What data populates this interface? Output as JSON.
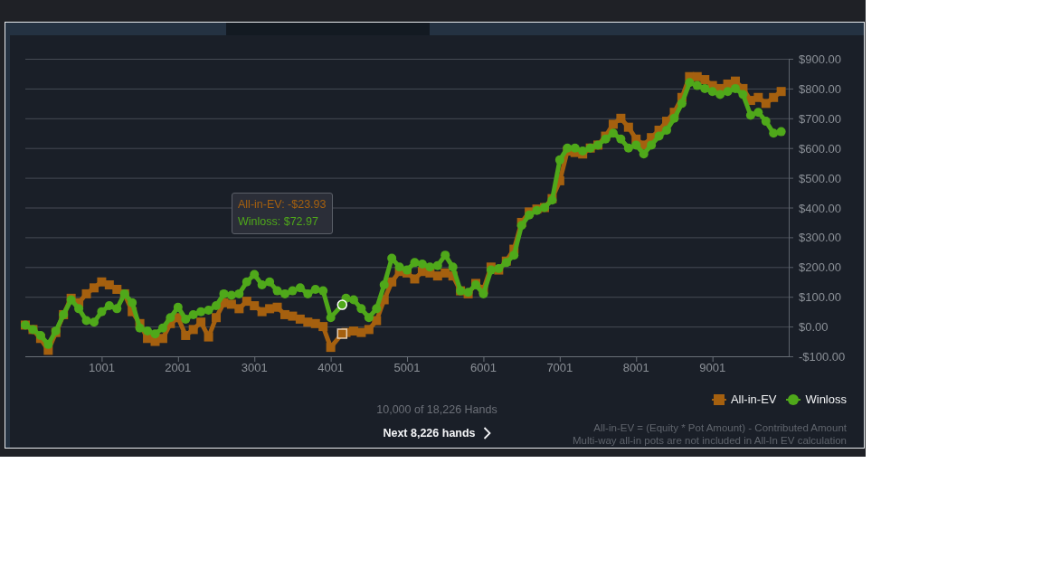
{
  "tabs": [
    {
      "selected": false
    },
    {
      "selected": true
    },
    {
      "selected": false
    }
  ],
  "chart": {
    "chart_data": {
      "type": "line",
      "grid": true,
      "x": [
        1,
        101,
        201,
        301,
        401,
        501,
        601,
        701,
        801,
        901,
        1001,
        1101,
        1201,
        1301,
        1401,
        1501,
        1601,
        1701,
        1801,
        1901,
        2001,
        2101,
        2201,
        2301,
        2401,
        2501,
        2601,
        2701,
        2801,
        2901,
        3001,
        3101,
        3201,
        3301,
        3401,
        3501,
        3601,
        3701,
        3801,
        3901,
        4001,
        4151,
        4201,
        4301,
        4401,
        4501,
        4601,
        4701,
        4801,
        4901,
        5001,
        5101,
        5201,
        5301,
        5401,
        5501,
        5601,
        5701,
        5801,
        5901,
        6001,
        6101,
        6201,
        6301,
        6401,
        6501,
        6601,
        6701,
        6801,
        6901,
        7001,
        7101,
        7201,
        7301,
        7401,
        7501,
        7601,
        7701,
        7801,
        7901,
        8001,
        8101,
        8201,
        8301,
        8401,
        8501,
        8601,
        8701,
        8801,
        8901,
        9001,
        9101,
        9201,
        9301,
        9401,
        9501,
        9601,
        9701,
        9801,
        9901
      ],
      "xlim": [
        1,
        10000
      ],
      "ylim": [
        -100,
        900
      ],
      "xticks": [
        1001,
        2001,
        3001,
        4001,
        5001,
        6001,
        7001,
        8001,
        9001
      ],
      "yticks": [
        {
          "value": 900,
          "label": "$900.00"
        },
        {
          "value": 800,
          "label": "$800.00"
        },
        {
          "value": 700,
          "label": "$700.00"
        },
        {
          "value": 600,
          "label": "$600.00"
        },
        {
          "value": 500,
          "label": "$500.00"
        },
        {
          "value": 400,
          "label": "$400.00"
        },
        {
          "value": 300,
          "label": "$300.00"
        },
        {
          "value": 200,
          "label": "$200.00"
        },
        {
          "value": 100,
          "label": "$100.00"
        },
        {
          "value": 0,
          "label": "$0.00"
        },
        {
          "value": -100,
          "label": "-$100.00"
        }
      ],
      "series": [
        {
          "name": "All-in-EV",
          "marker": "square",
          "color": "#a5600f",
          "values": [
            5,
            -10,
            -40,
            -80,
            -20,
            40,
            95,
            80,
            110,
            130,
            150,
            140,
            125,
            110,
            50,
            10,
            -40,
            -50,
            -40,
            10,
            30,
            -30,
            -10,
            15,
            -35,
            30,
            80,
            75,
            60,
            85,
            70,
            50,
            60,
            65,
            40,
            35,
            25,
            15,
            10,
            0,
            -70,
            -23.93,
            -20,
            -15,
            -20,
            -10,
            20,
            90,
            150,
            185,
            180,
            160,
            185,
            180,
            170,
            180,
            170,
            120,
            110,
            145,
            125,
            200,
            190,
            220,
            260,
            350,
            385,
            395,
            400,
            430,
            490,
            590,
            585,
            580,
            600,
            610,
            640,
            680,
            700,
            670,
            630,
            610,
            635,
            660,
            690,
            720,
            770,
            840,
            840,
            830,
            810,
            800,
            815,
            825,
            800,
            760,
            770,
            750,
            770,
            790
          ]
        },
        {
          "name": "Winloss",
          "marker": "circle",
          "color": "#4fa81a",
          "values": [
            5,
            -10,
            -30,
            -60,
            -15,
            40,
            90,
            60,
            20,
            15,
            50,
            70,
            60,
            110,
            80,
            -5,
            -15,
            -25,
            -5,
            30,
            65,
            25,
            40,
            50,
            55,
            70,
            110,
            105,
            110,
            150,
            175,
            140,
            150,
            120,
            110,
            120,
            130,
            110,
            125,
            120,
            30,
            72.97,
            95,
            90,
            60,
            30,
            60,
            140,
            230,
            200,
            190,
            215,
            210,
            200,
            205,
            240,
            200,
            120,
            115,
            140,
            110,
            190,
            195,
            215,
            240,
            340,
            375,
            390,
            400,
            425,
            560,
            600,
            600,
            590,
            600,
            610,
            630,
            650,
            630,
            600,
            610,
            580,
            610,
            640,
            660,
            700,
            750,
            820,
            810,
            800,
            790,
            780,
            790,
            800,
            780,
            710,
            720,
            690,
            650,
            655
          ]
        },
        {
          "marker": "square",
          "color": "#e6cfb4",
          "values": [
            null,
            null,
            null,
            null,
            null,
            null,
            null,
            null,
            null,
            null,
            null,
            null,
            null,
            null,
            null,
            null,
            null,
            null,
            null,
            null,
            null,
            null,
            null,
            null,
            null,
            null,
            null,
            null,
            null,
            null,
            null,
            null,
            null,
            null,
            null,
            null,
            null,
            null,
            null,
            null,
            null,
            -23.93,
            null,
            null,
            null,
            null,
            null,
            null,
            null,
            null,
            null,
            null,
            null,
            null,
            null,
            null,
            null,
            null,
            null,
            null,
            null,
            null,
            null,
            null,
            null,
            null,
            null,
            null,
            null,
            null,
            null,
            null,
            null,
            null,
            null,
            null,
            null,
            null,
            null,
            null,
            null,
            null,
            null,
            null,
            null,
            null,
            null,
            null,
            null,
            null,
            null,
            null,
            null,
            null,
            null,
            null,
            null,
            null,
            null,
            null
          ]
        },
        {
          "marker": "circle",
          "color": "#ffffff",
          "values": [
            null,
            null,
            null,
            null,
            null,
            null,
            null,
            null,
            null,
            null,
            null,
            null,
            null,
            null,
            null,
            null,
            null,
            null,
            null,
            null,
            null,
            null,
            null,
            null,
            null,
            null,
            null,
            null,
            null,
            null,
            null,
            null,
            null,
            null,
            null,
            null,
            null,
            null,
            null,
            null,
            null,
            72.97,
            null,
            null,
            null,
            null,
            null,
            null,
            null,
            null,
            null,
            null,
            null,
            null,
            null,
            null,
            null,
            null,
            null,
            null,
            null,
            null,
            null,
            null,
            null,
            null,
            null,
            null,
            null,
            null,
            null,
            null,
            null,
            null,
            null,
            null,
            null,
            null,
            null,
            null,
            null,
            null,
            null,
            null,
            null,
            null,
            null,
            null,
            null,
            null,
            null,
            null,
            null,
            null,
            null,
            null,
            null,
            null,
            null,
            null
          ]
        }
      ],
      "annotations": [
        "All-in-EV: -$23.93",
        "Winloss: $72.97"
      ]
    }
  },
  "footer": {
    "hands_shown": "10,000 of 18,226 Hands",
    "next_button": {
      "label": "Next 8,226 hands"
    },
    "notes": [
      "All-in-EV = (Equity * Pot Amount) - Contributed Amount",
      "Multi-way all-in pots are not included in All-In EV calculation"
    ]
  }
}
